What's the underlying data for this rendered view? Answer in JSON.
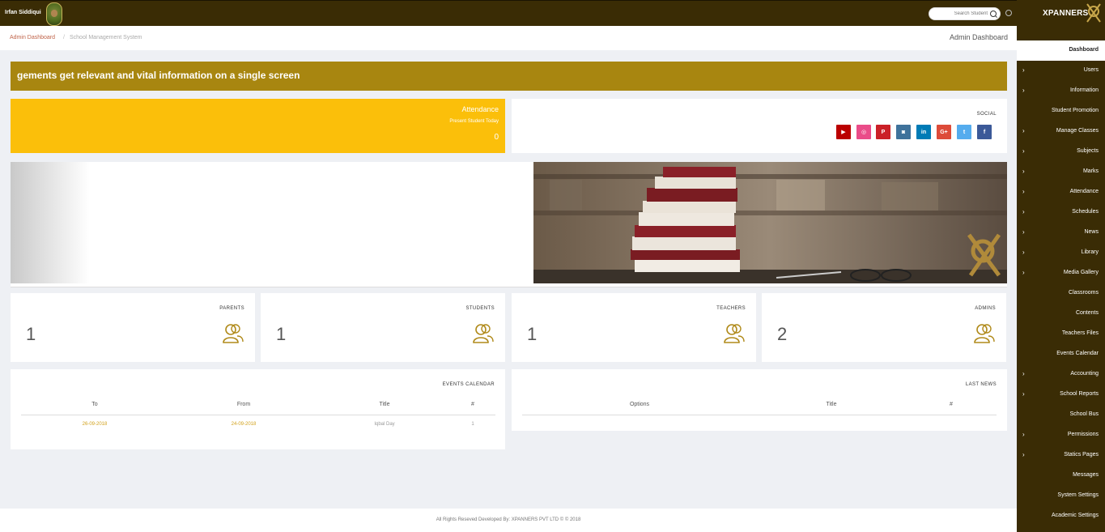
{
  "topbar": {
    "user_name": "Irfan Siddiqui",
    "search_placeholder": "Search Student"
  },
  "brand": {
    "name": "XPANNERS"
  },
  "sidebar": {
    "items": [
      {
        "label": "Dashboard",
        "icon": "dashboard-icon",
        "active": true,
        "has_submenu": false
      },
      {
        "label": "Users",
        "icon": "user-icon",
        "has_submenu": true
      },
      {
        "label": "Information",
        "icon": "lightbulb-icon",
        "has_submenu": true
      },
      {
        "label": "Student Promotion",
        "icon": "refresh-icon",
        "has_submenu": false
      },
      {
        "label": "Manage Classes",
        "icon": "graduation-cap-icon",
        "has_submenu": true
      },
      {
        "label": "Subjects",
        "icon": "edit-icon",
        "has_submenu": true
      },
      {
        "label": "Marks",
        "icon": "graduation-cap-icon",
        "has_submenu": true
      },
      {
        "label": "Attendance",
        "icon": "check-square-icon",
        "has_submenu": true
      },
      {
        "label": "Schedules",
        "icon": "calendar-icon",
        "has_submenu": true
      },
      {
        "label": "News",
        "icon": "newspaper-icon",
        "has_submenu": true
      },
      {
        "label": "Library",
        "icon": "book-icon",
        "has_submenu": true
      },
      {
        "label": "Media Gallery",
        "icon": "image-icon",
        "has_submenu": true
      },
      {
        "label": "Classrooms",
        "icon": "home-icon",
        "has_submenu": false
      },
      {
        "label": "Contents",
        "icon": "open-book-icon",
        "has_submenu": false
      },
      {
        "label": "Teachers Files",
        "icon": "files-icon",
        "has_submenu": false
      },
      {
        "label": "Events Calendar",
        "icon": "calendar-icon",
        "has_submenu": false
      },
      {
        "label": "Accounting",
        "icon": "money-icon",
        "has_submenu": true
      },
      {
        "label": "School Reports",
        "icon": "bar-chart-icon",
        "has_submenu": true
      },
      {
        "label": "School Bus",
        "icon": "bus-icon",
        "has_submenu": false
      },
      {
        "label": "Permissions",
        "icon": "minus-square-icon",
        "has_submenu": true
      },
      {
        "label": "Statics Pages",
        "icon": "flag-icon",
        "has_submenu": true
      },
      {
        "label": "Messages",
        "icon": "envelope-icon",
        "has_submenu": false
      },
      {
        "label": "System Settings",
        "icon": "gear-icon",
        "has_submenu": false
      },
      {
        "label": "Academic Settings",
        "icon": "graduation-cap-icon",
        "has_submenu": false
      }
    ]
  },
  "breadcrumb": {
    "home": "Admin Dashboard",
    "separator": "/",
    "current": "School Management System"
  },
  "page_title": "Admin Dashboard",
  "marquee": {
    "text": "gements get relevant and vital information on a single screen"
  },
  "attendance": {
    "title": "Attendance",
    "subtitle": "Present Student Today",
    "value": "0"
  },
  "social": {
    "title": "SOCIAL",
    "buttons": [
      {
        "name": "youtube",
        "glyph": "▶",
        "color": "#bb0000"
      },
      {
        "name": "dribbble",
        "glyph": "◎",
        "color": "#ea4c89"
      },
      {
        "name": "pinterest",
        "glyph": "P",
        "color": "#cb2027"
      },
      {
        "name": "instagram",
        "glyph": "◙",
        "color": "#3f729b"
      },
      {
        "name": "linkedin",
        "glyph": "in",
        "color": "#007bb6"
      },
      {
        "name": "google-plus",
        "glyph": "G+",
        "color": "#dd4b39"
      },
      {
        "name": "twitter",
        "glyph": "t",
        "color": "#55acee"
      },
      {
        "name": "facebook",
        "glyph": "f",
        "color": "#3b5998"
      }
    ]
  },
  "stats": [
    {
      "label": "PARENTS",
      "value": "1"
    },
    {
      "label": "STUDENTS",
      "value": "1"
    },
    {
      "label": "TEACHERS",
      "value": "1"
    },
    {
      "label": "ADMINS",
      "value": "2"
    }
  ],
  "events": {
    "title": "EVENTS CALENDAR",
    "headers": [
      "To",
      "From",
      "Title",
      "#"
    ],
    "rows": [
      {
        "to": "26-09-2018",
        "from": "24-09-2018",
        "title": "Iqbal Day",
        "num": "1"
      }
    ]
  },
  "news": {
    "title": "LAST NEWS",
    "headers": [
      "Options",
      "Title",
      "#"
    ]
  },
  "footer": {
    "text": "All Rights Reseved Developed By: XPANNERS PVT LTD © © 2018"
  },
  "colors": {
    "dark": "#3a2c05",
    "gold": "#a88610",
    "yellow": "#fbbf0a",
    "accent": "#d2a21d"
  }
}
